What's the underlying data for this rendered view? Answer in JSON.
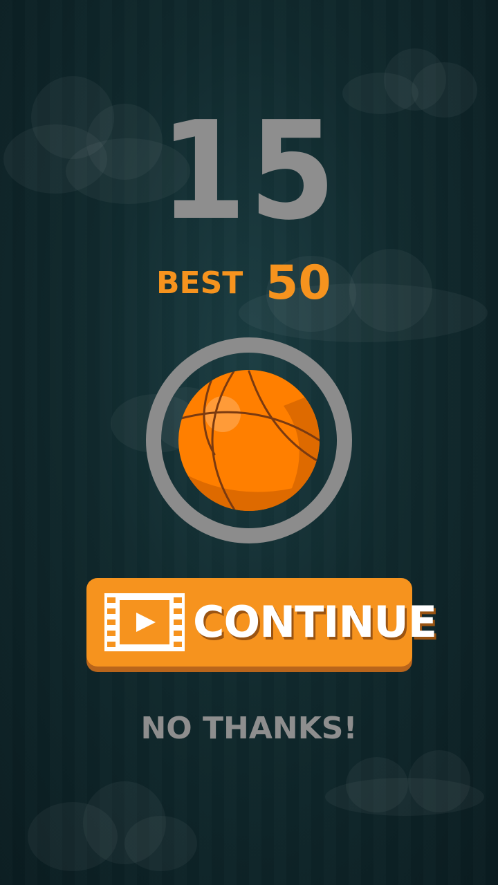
{
  "game": {
    "score": "15",
    "best_label": "BEST",
    "best_value": "50"
  },
  "buttons": {
    "continue_label": "CONTINUE",
    "continue_icon": "video-film-play-icon",
    "no_thanks_label": "NO THANKS!"
  },
  "colors": {
    "background": "#10292d",
    "accent_orange": "#f6931e",
    "score_gray": "#8e8e8e",
    "ball_orange": "#ff7f00",
    "ring_gray": "#8c8c8c"
  }
}
